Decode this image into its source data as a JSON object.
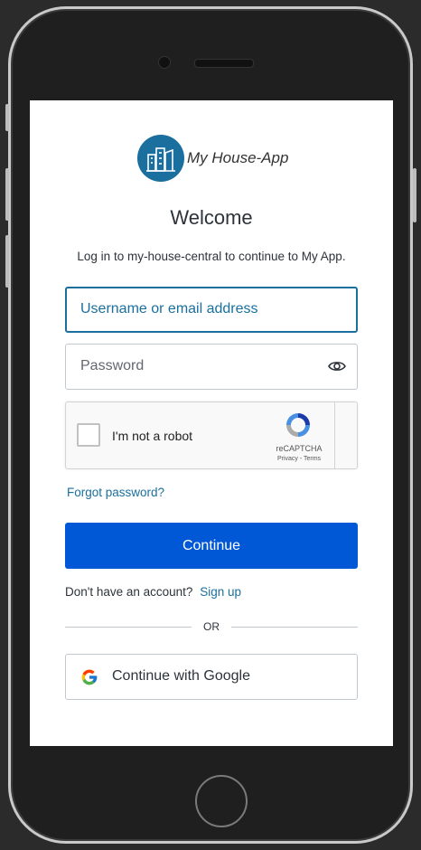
{
  "app": {
    "logo_text": "My House-App",
    "logo_icon": "building-icon",
    "brand_color": "#1a6f9e"
  },
  "login": {
    "title": "Welcome",
    "subtitle": "Log in to my-house-central to continue to My App.",
    "username_placeholder": "Username or email address",
    "password_placeholder": "Password",
    "password_icon": "eye-icon",
    "forgot_password": "Forgot password?",
    "continue_label": "Continue",
    "no_account_text": "Don't have an account?",
    "signup_link": "Sign up",
    "divider_text": "OR",
    "google_label": "Continue with Google",
    "button_color": "#0058d6"
  },
  "captcha": {
    "label": "I'm not a robot",
    "brand": "reCAPTCHA",
    "links": "Privacy - Terms",
    "checked": false
  }
}
